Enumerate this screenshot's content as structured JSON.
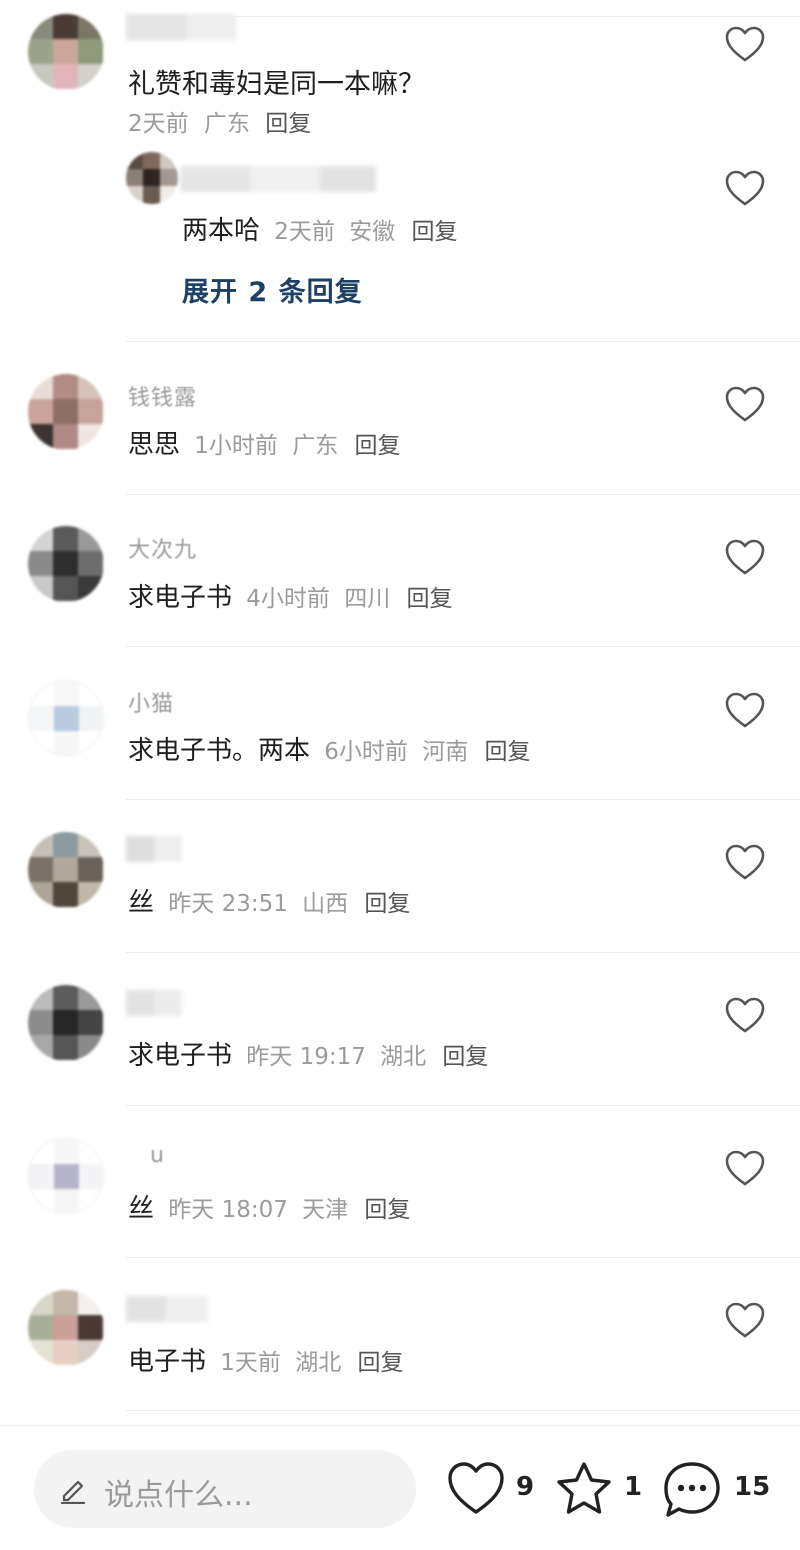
{
  "comments": [
    {
      "content": "礼赞和毒妇是同一本嘛？",
      "time": "2天前",
      "location": "广东",
      "reply": "回复"
    },
    {
      "content": "两本哈",
      "time": "2天前",
      "location": "安徽",
      "reply": "回复"
    },
    {
      "content": "思思",
      "time": "1小时前",
      "location": "广东",
      "reply": "回复",
      "name_fragment": "钱钱露"
    },
    {
      "content": "求电子书",
      "time": "4小时前",
      "location": "四川",
      "reply": "回复",
      "name_fragment": "大次九"
    },
    {
      "content": "求电子书。两本",
      "time": "6小时前",
      "location": "河南",
      "reply": "回复",
      "name_fragment": "小猫"
    },
    {
      "content": "丝",
      "time": "昨天 23:51",
      "location": "山西",
      "reply": "回复"
    },
    {
      "content": "求电子书",
      "time": "昨天 19:17",
      "location": "湖北",
      "reply": "回复"
    },
    {
      "content": "丝",
      "time": "昨天 18:07",
      "location": "天津",
      "reply": "回复",
      "name_fragment": "u"
    },
    {
      "content": "电子书",
      "time": "1天前",
      "location": "湖北",
      "reply": "回复"
    }
  ],
  "expand_replies": "展开 2 条回复",
  "bottom_bar": {
    "input_placeholder": "说点什么...",
    "like_count": "9",
    "star_count": "1",
    "comment_count": "15"
  },
  "icons": {
    "like": "heart-outline-icon",
    "input": "pencil-icon",
    "favorite": "star-outline-icon",
    "comments": "chat-bubble-icon"
  },
  "colors": {
    "expand_link": "#1e3f66",
    "meta_text": "#9b9b9b",
    "icon_stroke": "#555555"
  }
}
